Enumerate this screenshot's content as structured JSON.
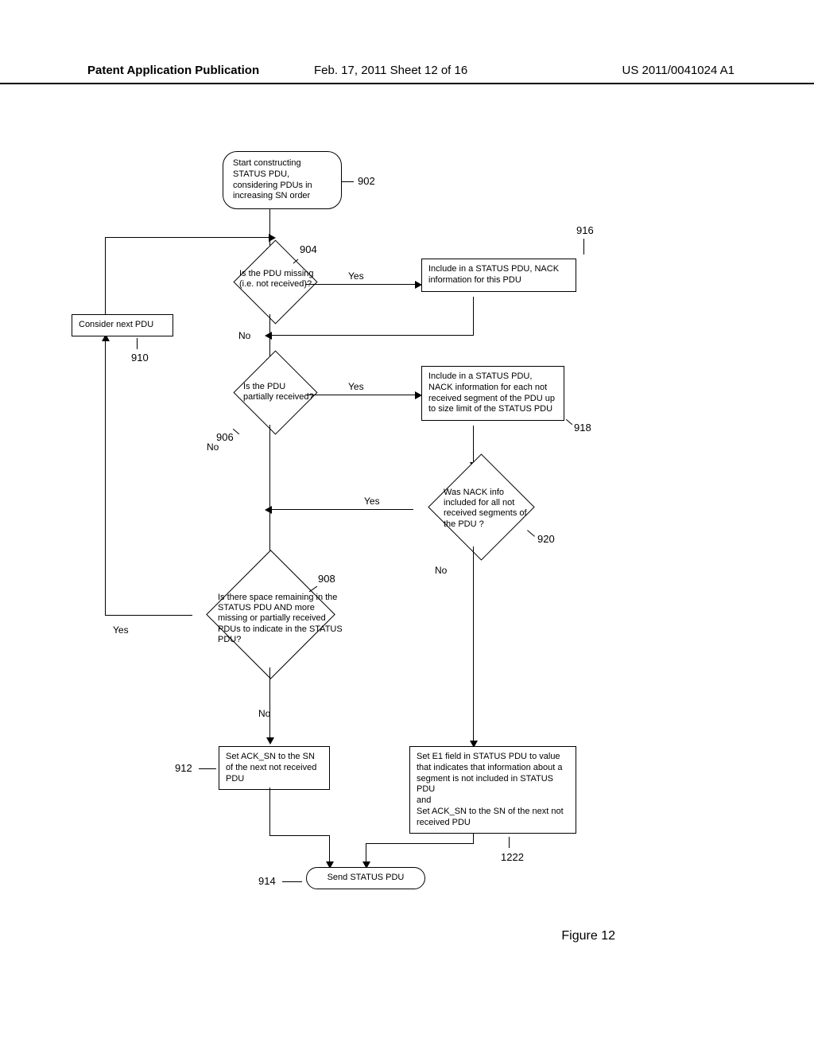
{
  "header": {
    "left": "Patent Application Publication",
    "center": "Feb. 17, 2011  Sheet 12 of 16",
    "right": "US 2011/0041024 A1"
  },
  "figure_label": "Figure 12",
  "refs": {
    "r902": "902",
    "r904": "904",
    "r906": "906",
    "r908": "908",
    "r910": "910",
    "r912": "912",
    "r914": "914",
    "r916": "916",
    "r918": "918",
    "r920": "920",
    "r1222": "1222"
  },
  "nodes": {
    "start": "Start constructing STATUS PDU, considering PDUs in increasing SN order",
    "d904": "Is the PDU missing (i.e. not received)?",
    "p910": "Consider next PDU",
    "p916": "Include in a STATUS PDU, NACK information for this PDU",
    "d906": "Is the PDU partially received?",
    "p918": "Include in a STATUS PDU, NACK information for each not received segment of the PDU up to size limit of the STATUS PDU",
    "d920": "Was NACK info included for all not received segments of the PDU ?",
    "d908": "Is there space remaining in the STATUS PDU AND more missing or partially received PDUs to indicate in the STATUS PDU?",
    "p912": "Set ACK_SN to the SN of the next not received PDU",
    "p1222": "Set E1 field in STATUS PDU to value that indicates that information about a segment is not included in STATUS PDU\nand\nSet ACK_SN to the SN of the next not received PDU",
    "end": "Send STATUS PDU"
  },
  "labels": {
    "yes": "Yes",
    "no": "No"
  }
}
